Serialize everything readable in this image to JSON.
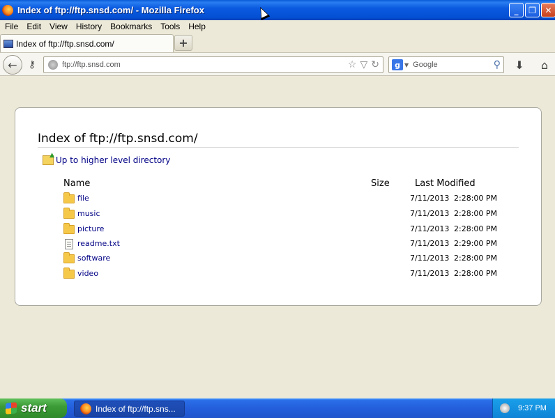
{
  "window": {
    "title": "Index of ftp://ftp.snsd.com/ - Mozilla Firefox",
    "minimize_icon": "minimize-icon",
    "maximize_icon": "maximize-icon",
    "close_icon": "close-icon"
  },
  "menubar": {
    "items": [
      {
        "label": "File",
        "key": "F"
      },
      {
        "label": "Edit",
        "key": "E"
      },
      {
        "label": "View",
        "key": "V"
      },
      {
        "label": "History",
        "key": "s"
      },
      {
        "label": "Bookmarks",
        "key": "B"
      },
      {
        "label": "Tools",
        "key": "T"
      },
      {
        "label": "Help",
        "key": "H"
      }
    ]
  },
  "tabs": [
    {
      "label": "Index of ftp://ftp.snsd.com/",
      "icon": "page-icon"
    }
  ],
  "newtab": {
    "label": "+"
  },
  "navbar": {
    "back_icon": "back-arrow-icon",
    "identity_icon": "key-icon",
    "url": "ftp://ftp.snsd.com",
    "bookmark_icon": "star-icon",
    "reload_icon": "reload-icon",
    "search_engine": "Google",
    "search_placeholder": "Google",
    "download_icon": "download-icon",
    "home_icon": "home-icon"
  },
  "page": {
    "heading": "Index of ftp://ftp.snsd.com/",
    "up_link": "Up to higher level directory",
    "columns": {
      "name": "Name",
      "size": "Size",
      "modified": "Last Modified"
    },
    "files": [
      {
        "name": "file",
        "type": "folder",
        "size": "",
        "date": "7/11/2013",
        "time": "2:28:00 PM"
      },
      {
        "name": "music",
        "type": "folder",
        "size": "",
        "date": "7/11/2013",
        "time": "2:28:00 PM"
      },
      {
        "name": "picture",
        "type": "folder",
        "size": "",
        "date": "7/11/2013",
        "time": "2:28:00 PM"
      },
      {
        "name": "readme.txt",
        "type": "file",
        "size": "",
        "date": "7/11/2013",
        "time": "2:29:00 PM"
      },
      {
        "name": "software",
        "type": "folder",
        "size": "",
        "date": "7/11/2013",
        "time": "2:28:00 PM"
      },
      {
        "name": "video",
        "type": "folder",
        "size": "",
        "date": "7/11/2013",
        "time": "2:28:00 PM"
      }
    ]
  },
  "taskbar": {
    "start_label": "start",
    "task_label": "Index of ftp://ftp.sns...",
    "clock": "9:37 PM"
  },
  "colors": {
    "titlebar": "#0450d4",
    "link": "#000085",
    "start": "#3c9b36",
    "taskbar": "#245edb"
  }
}
